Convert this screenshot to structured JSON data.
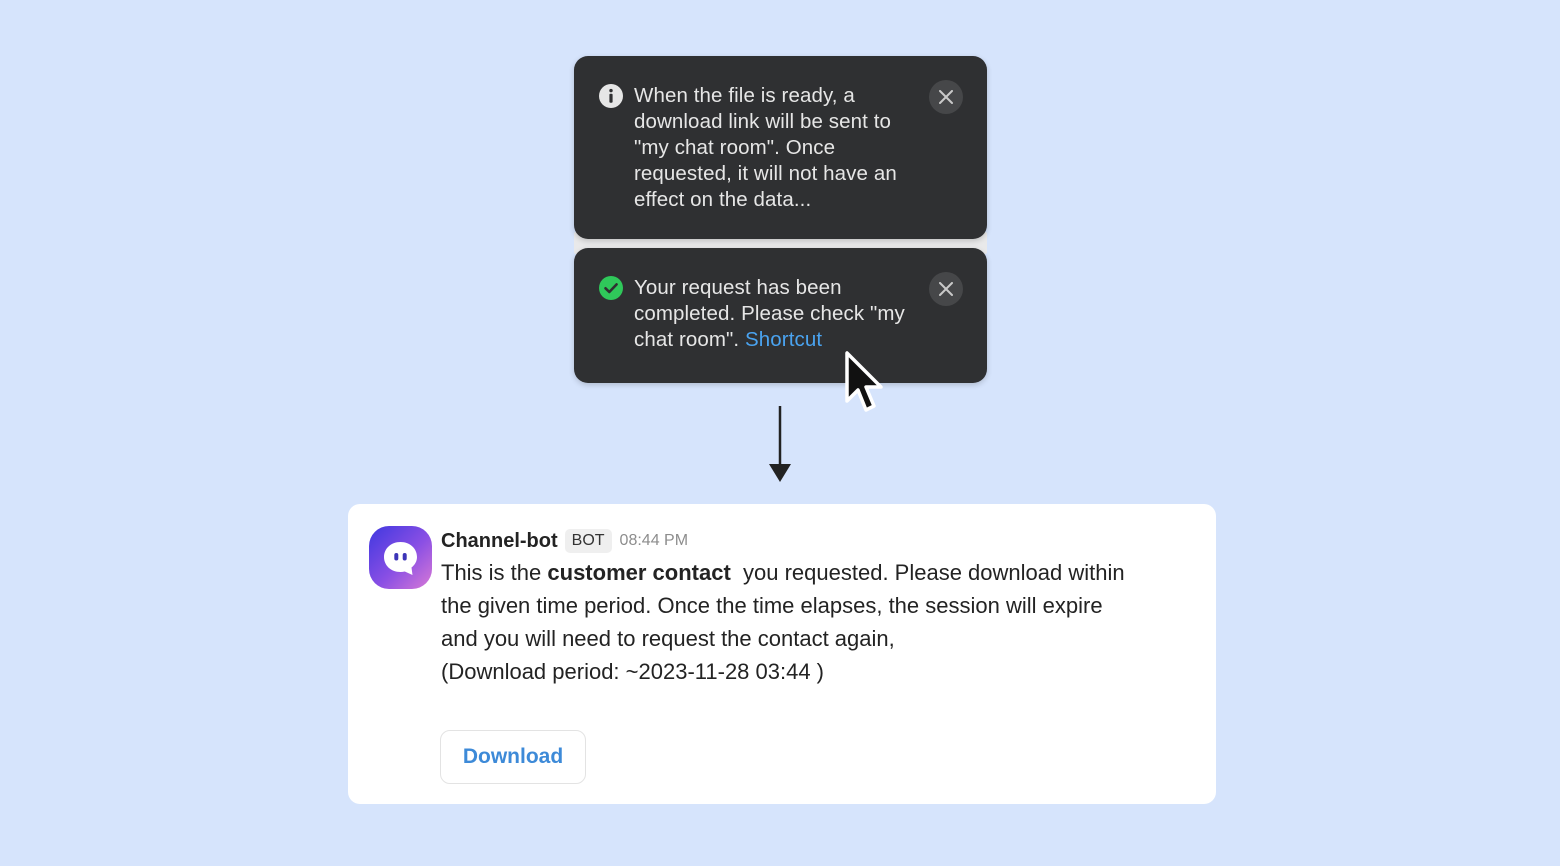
{
  "toasts": {
    "info": {
      "icon": "info-icon",
      "message": "When the file is ready, a download link will be sent to \"my chat room\". Once requested, it will not have an effect on the data..."
    },
    "success": {
      "icon": "check-circle-icon",
      "message": "Your request has been completed. Please check \"my chat room\".",
      "link_label": "Shortcut"
    }
  },
  "message": {
    "sender": "Channel-bot",
    "badge": "BOT",
    "time": "08:44 PM",
    "body_prefix": "This is the",
    "body_bold": "customer contact",
    "body_suffix": "you requested. Please download within the given time period. Once the time elapses, the session will expire and you will need to request the contact again,",
    "download_period": "(Download period: ~2023-11-28 03:44 )",
    "download_label": "Download"
  },
  "colors": {
    "background": "#d6e4fc",
    "toast_bg": "#2f3032",
    "link": "#4aa3f0",
    "success": "#2fc85a",
    "download_text": "#3d8ad8",
    "avatar_gradient_start": "#4a3ee0",
    "avatar_gradient_end": "#c46ad8"
  }
}
